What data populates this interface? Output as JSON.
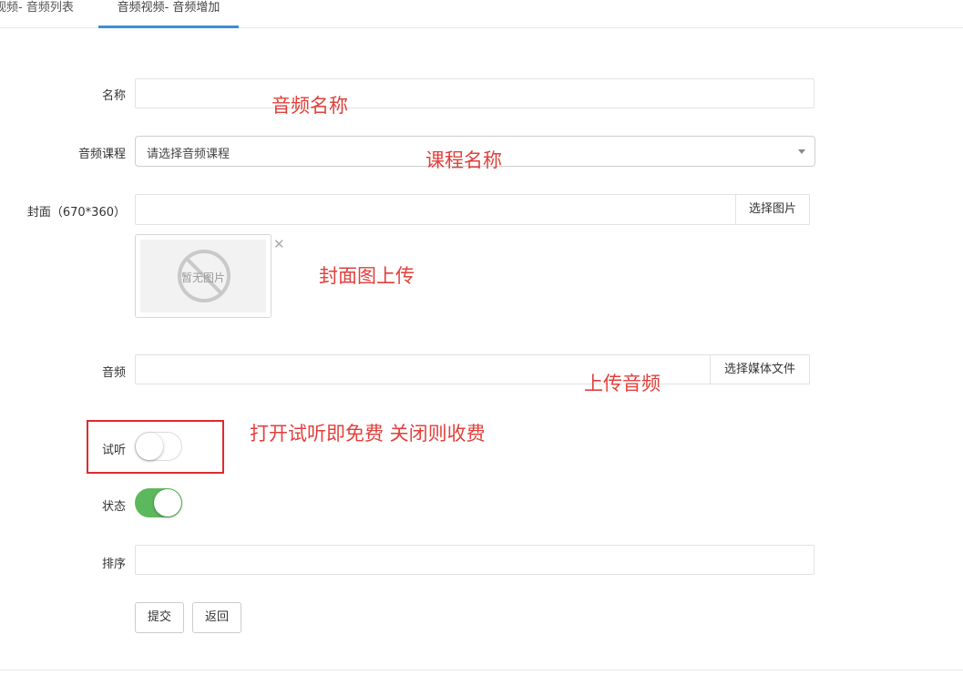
{
  "tabs": [
    {
      "label": "视频- 音频列表",
      "active": false
    },
    {
      "label": "音频视频- 音频增加",
      "active": true
    }
  ],
  "form": {
    "name": {
      "label": "名称",
      "value": ""
    },
    "course": {
      "label": "音频课程",
      "selected": "请选择音频课程"
    },
    "cover": {
      "label": "封面（670*360）",
      "value": "",
      "button": "选择图片",
      "placeholder_image_text": "暂无图片"
    },
    "audio": {
      "label": "音频",
      "value": "",
      "button": "选择媒体文件"
    },
    "trial": {
      "label": "试听",
      "on": false
    },
    "status": {
      "label": "状态",
      "on": true
    },
    "sort": {
      "label": "排序",
      "value": ""
    },
    "submit_label": "提交",
    "back_label": "返回"
  },
  "annotations": {
    "name": "音频名称",
    "course": "课程名称",
    "cover": "封面图上传",
    "audio": "上传音频",
    "trial": "打开试听即免费  关闭则收费"
  },
  "colors": {
    "tab_active": "#3b8fd8",
    "switch_on": "#5cb85c",
    "annotation": "#e2403c",
    "highlight_box": "#e02b2b"
  }
}
